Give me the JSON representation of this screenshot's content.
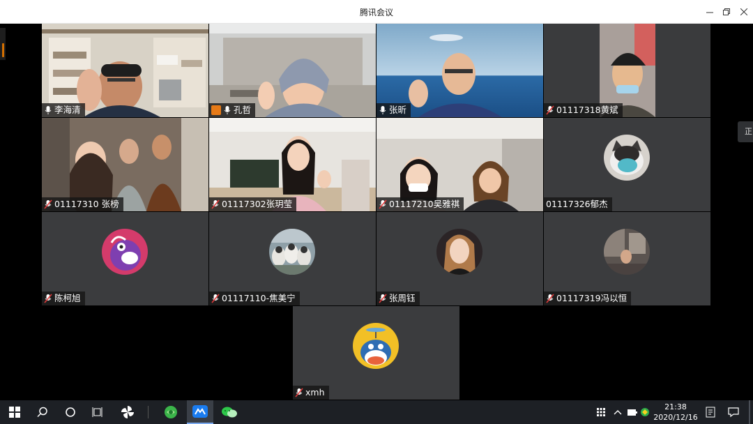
{
  "window": {
    "title": "腾讯会议"
  },
  "side_tab": {
    "label": "正在"
  },
  "participants": [
    {
      "name": "李海清",
      "mic": "on",
      "kind": "video"
    },
    {
      "name": "孔哲",
      "mic": "on",
      "kind": "video",
      "host_badge": true
    },
    {
      "name": "张昕",
      "mic": "on",
      "kind": "video"
    },
    {
      "name": "01117318黄斌",
      "mic": "muted",
      "kind": "video"
    },
    {
      "name": "01117310 张榜",
      "mic": "muted",
      "kind": "video"
    },
    {
      "name": "01117302张玥莹",
      "mic": "muted",
      "kind": "video"
    },
    {
      "name": "01117210吴雅祺",
      "mic": "muted",
      "kind": "video"
    },
    {
      "name": "01117326郁杰",
      "mic": "none",
      "kind": "avatar"
    },
    {
      "name": "陈柯旭",
      "mic": "muted",
      "kind": "avatar"
    },
    {
      "name": "01117110-焦美宁",
      "mic": "muted",
      "kind": "avatar"
    },
    {
      "name": "张周钰",
      "mic": "muted",
      "kind": "avatar"
    },
    {
      "name": "01117319冯以恒",
      "mic": "muted",
      "kind": "avatar"
    },
    {
      "name": "xmh",
      "mic": "muted",
      "kind": "avatar"
    }
  ],
  "taskbar": {
    "icons": [
      "windows-start-icon",
      "search-icon",
      "cortana-icon",
      "task-view-icon",
      "pinwheel-app-icon",
      "browser-icon",
      "tencent-meeting-icon",
      "wechat-icon"
    ],
    "tray_icons": [
      "grid-ime-icon",
      "chevron-up-icon",
      "battery-icon",
      "tray-app-icon",
      "notes-icon",
      "notification-icon"
    ],
    "time": "21:38",
    "date": "2020/12/16"
  },
  "colors": {
    "tile_bg": "#3b3c3e",
    "muted_mic": "#e23b3b",
    "active_taskbar": "#7aa9ef"
  }
}
